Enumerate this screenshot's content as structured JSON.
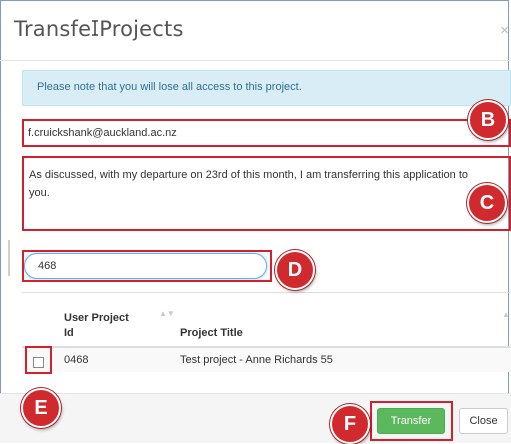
{
  "dialog": {
    "title_part1": "Transfe",
    "title_part2": "Projects",
    "close_glyph": "×"
  },
  "alert": {
    "text": "Please note that you will lose all access to this project."
  },
  "form": {
    "email_value": "f.cruickshank@auckland.ac.nz",
    "message_value": "As discussed, with my departure on 23rd of this month, I am transferring this application to you.",
    "search_value": "468"
  },
  "table": {
    "columns": [
      "User Project Id",
      "Project Title"
    ],
    "rows": [
      {
        "id": "0468",
        "title": "Test project - Anne Richards 55"
      }
    ]
  },
  "table_view": {
    "col1_line1": "User Project",
    "col1_line2": "Id",
    "col2": "Project Title",
    "row1_id": "0468",
    "row1_title": "Test project - Anne Richards 55",
    "sort_glyph": "▲▼"
  },
  "buttons": {
    "transfer": "Transfer",
    "close": "Close"
  },
  "annotations": {
    "B": "B",
    "C": "C",
    "D": "D",
    "E": "E",
    "F": "F"
  },
  "colors": {
    "callout_red": "#d0212c",
    "transfer_green": "#5cb85c",
    "alert_bg": "#d9edf7",
    "alert_text": "#31708f"
  }
}
